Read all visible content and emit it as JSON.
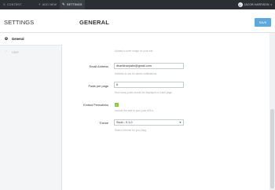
{
  "topbar": {
    "nav": [
      {
        "label": "CONTENT",
        "icon": "list-icon"
      },
      {
        "label": "ADD NEW",
        "icon": "plus-icon"
      },
      {
        "label": "SETTINGS",
        "icon": "wrench-icon"
      }
    ],
    "user": "JACOB HARRISON"
  },
  "sidebar": {
    "title": "SETTINGS",
    "items": [
      {
        "label": "General",
        "icon": "gear-icon"
      },
      {
        "label": "User",
        "icon": "user-icon"
      }
    ]
  },
  "main": {
    "title": "GENERAL",
    "save_label": "SAVE",
    "top_help": "Upload a cover image on your site.",
    "fields": {
      "email": {
        "label": "Email Address",
        "value": "dhankharyatin@gmail.com",
        "help": "Address to use for admin notifications."
      },
      "posts": {
        "label": "Posts per page",
        "value": "6",
        "help": "How many posts should be displayed on each page."
      },
      "permalinks": {
        "label": "Embed Permalinks",
        "checked": true,
        "help": "Include the date in your post URLs."
      },
      "theme": {
        "label": "Theme",
        "value": "Scub - 0.1.0",
        "help": "Select a theme for your blog."
      }
    }
  },
  "colors": {
    "accent": "#5fa8dc",
    "topbar": "#2b2f33",
    "checkbox": "#8bc34a"
  }
}
